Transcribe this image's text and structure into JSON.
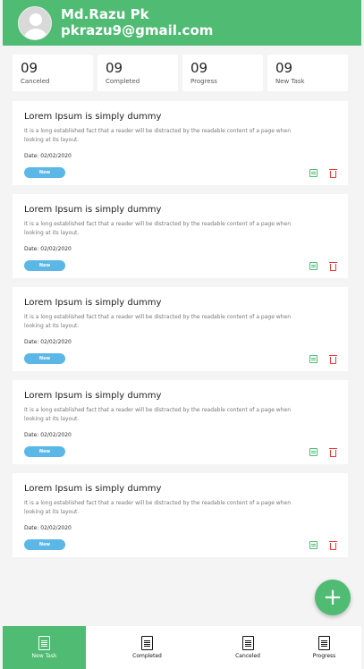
{
  "header": {
    "name": "Md.Razu Pk",
    "email": "pkrazu9@gmail.com",
    "avatar_icon": "user-avatar-icon",
    "background_color": "#4fbb73"
  },
  "summary": [
    {
      "count": "09",
      "label": "Canceled"
    },
    {
      "count": "09",
      "label": "Completed"
    },
    {
      "count": "09",
      "label": "Progress"
    },
    {
      "count": "09",
      "label": "New Task"
    }
  ],
  "tasks": [
    {
      "title": "Lorem Ipsum is simply dummy",
      "description": "It is a long established fact that a reader will be distracted by the readable content of a page when looking at its layout.",
      "date": "Date: 02/02/2020",
      "status": "New"
    },
    {
      "title": "Lorem Ipsum is simply dummy",
      "description": "It is a long established fact that a reader will be distracted by the readable content of a page when looking at its layout.",
      "date": "Date: 02/02/2020",
      "status": "New"
    },
    {
      "title": "Lorem Ipsum is simply dummy",
      "description": "It is a long established fact that a reader will be distracted by the readable content of a page when looking at its layout.",
      "date": "Date: 02/02/2020",
      "status": "New"
    },
    {
      "title": "Lorem Ipsum is simply dummy",
      "description": "It is a long established fact that a reader will be distracted by the readable content of a page when looking at its layout.",
      "date": "Date: 02/02/2020",
      "status": "New"
    },
    {
      "title": "Lorem Ipsum is simply dummy",
      "description": "It is a long established fact that a reader will be distracted by the readable content of a page when looking at its layout.",
      "date": "Date: 02/02/2020",
      "status": "New"
    }
  ],
  "fab": {
    "label": "+",
    "icon": "plus-icon"
  },
  "bottom_nav": [
    {
      "label": "New Task",
      "icon": "document-icon",
      "active": true
    },
    {
      "label": "Completed",
      "icon": "document-icon",
      "active": false
    },
    {
      "label": "Canceled",
      "icon": "document-icon",
      "active": false
    },
    {
      "label": "Progress",
      "icon": "document-icon",
      "active": false
    }
  ],
  "colors": {
    "accent": "#4fbb73",
    "status_badge": "#5bb7e6",
    "delete": "#e53935",
    "background": "#f4f4f4"
  }
}
